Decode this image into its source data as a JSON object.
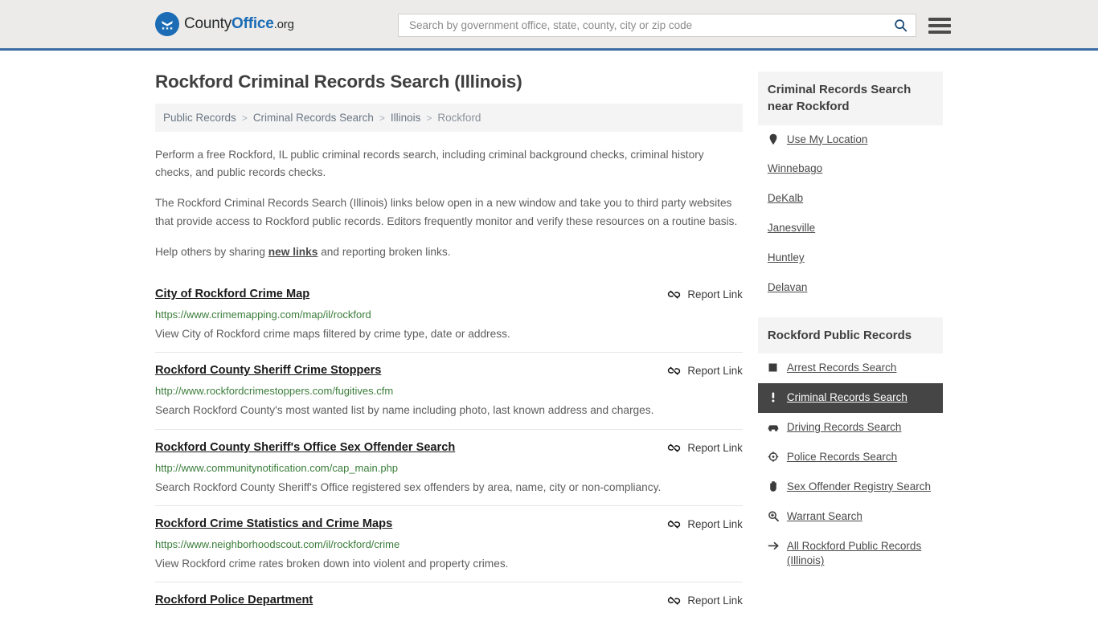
{
  "header": {
    "logo": {
      "part1": "County",
      "part2": "Office",
      "part3": ".org",
      "icon": "eagle-shield-icon"
    },
    "search": {
      "placeholder": "Search by government office, state, county, city or zip code",
      "value": "",
      "search_icon": "search-icon"
    },
    "menu_icon": "hamburger-menu-icon",
    "accent_color": "#3c6ea5",
    "background_color": "#ecebe9"
  },
  "page_title": "Rockford Criminal Records Search (Illinois)",
  "breadcrumb": {
    "separator": ">",
    "items": [
      {
        "label": "Public Records",
        "current": false
      },
      {
        "label": "Criminal Records Search",
        "current": false
      },
      {
        "label": "Illinois",
        "current": false
      },
      {
        "label": "Rockford",
        "current": true
      }
    ]
  },
  "intro": {
    "p1": "Perform a free Rockford, IL public criminal records search, including criminal background checks, criminal history checks, and public records checks.",
    "p2": "The Rockford Criminal Records Search (Illinois) links below open in a new window and take you to third party websites that provide access to Rockford public records. Editors frequently monitor and verify these resources on a routine basis.",
    "p3_before": "Help others by sharing ",
    "p3_link": "new links",
    "p3_after": " and reporting broken links."
  },
  "report_link_label": "Report Link",
  "report_link_icon": "broken-link-icon",
  "results": [
    {
      "title": "City of Rockford Crime Map",
      "url": "https://www.crimemapping.com/map/il/rockford",
      "description": "View City of Rockford crime maps filtered by crime type, date or address."
    },
    {
      "title": "Rockford County Sheriff Crime Stoppers",
      "url": "http://www.rockfordcrimestoppers.com/fugitives.cfm",
      "description": "Search Rockford County's most wanted list by name including photo, last known address and charges."
    },
    {
      "title": "Rockford County Sheriff's Office Sex Offender Search",
      "url": "http://www.communitynotification.com/cap_main.php",
      "description": "Search Rockford County Sheriff's Office registered sex offenders by area, name, city or non-compliancy."
    },
    {
      "title": "Rockford Crime Statistics and Crime Maps",
      "url": "https://www.neighborhoodscout.com/il/rockford/crime",
      "description": "View Rockford crime rates broken down into violent and property crimes."
    },
    {
      "title": "Rockford Police Department",
      "url": "",
      "description": ""
    }
  ],
  "sidebar": {
    "nearby": {
      "heading": "Criminal Records Search near Rockford",
      "items": [
        {
          "label": "Use My Location",
          "icon": "map-pin-icon",
          "active": false
        },
        {
          "label": "Winnebago",
          "icon": "",
          "active": false
        },
        {
          "label": "DeKalb",
          "icon": "",
          "active": false
        },
        {
          "label": "Janesville",
          "icon": "",
          "active": false
        },
        {
          "label": "Huntley",
          "icon": "",
          "active": false
        },
        {
          "label": "Delavan",
          "icon": "",
          "active": false
        }
      ]
    },
    "public_records": {
      "heading": "Rockford Public Records",
      "items": [
        {
          "label": "Arrest Records Search",
          "icon": "filled-square-icon",
          "active": false
        },
        {
          "label": "Criminal Records Search",
          "icon": "exclamation-icon",
          "active": true
        },
        {
          "label": "Driving Records Search",
          "icon": "car-icon",
          "active": false
        },
        {
          "label": "Police Records Search",
          "icon": "badge-icon",
          "active": false
        },
        {
          "label": "Sex Offender Registry Search",
          "icon": "hand-icon",
          "active": false
        },
        {
          "label": "Warrant Search",
          "icon": "magnifier-plus-icon",
          "active": false
        },
        {
          "label": "All Rockford Public Records (Illinois)",
          "icon": "arrow-right-icon",
          "active": false
        }
      ]
    },
    "active_background": "#454545"
  }
}
